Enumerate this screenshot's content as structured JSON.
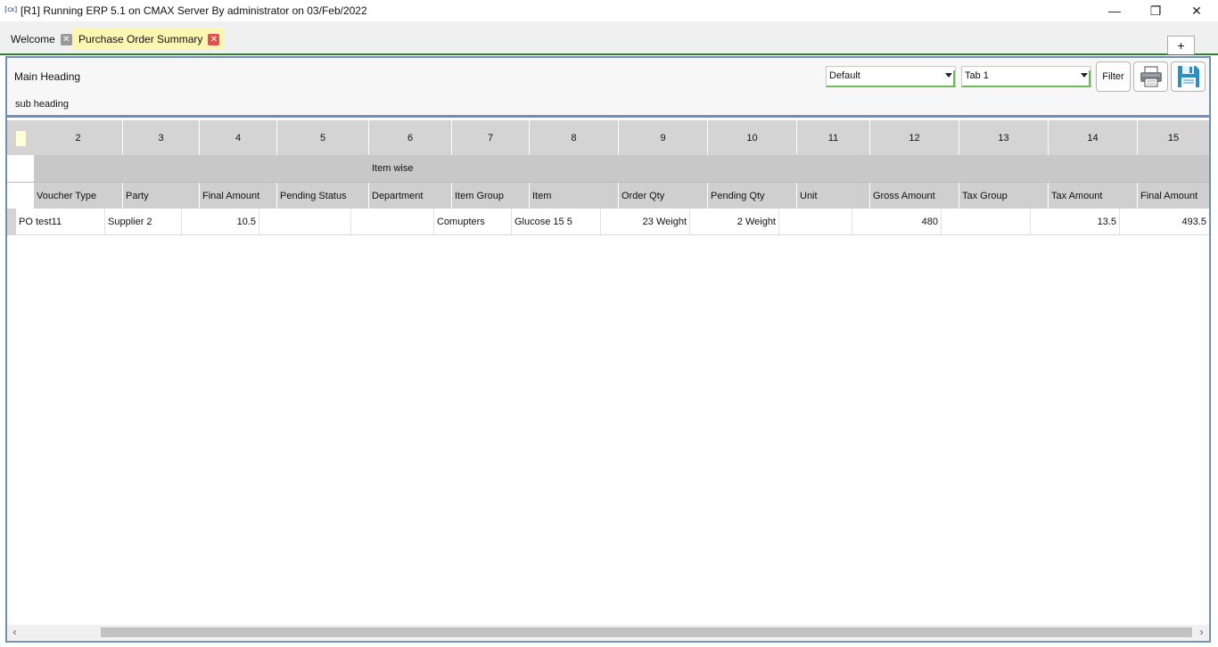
{
  "window": {
    "icon_text": "[cx]",
    "title": "[R1] Running ERP 5.1 on CMAX Server By administrator on 03/Feb/2022",
    "minimize": "—",
    "maximize": "❐",
    "close": "✕"
  },
  "tabs": [
    {
      "label": "Welcome",
      "close": "✕"
    },
    {
      "label": "Purchase Order Summary",
      "close": "✕"
    }
  ],
  "add_tab": "+",
  "header": {
    "main_heading": "Main Heading",
    "sub_heading": "sub heading",
    "view_select": "Default",
    "tab_select": "Tab 1",
    "filter_label": "Filter"
  },
  "grid": {
    "column_numbers": [
      "2",
      "3",
      "4",
      "5",
      "6",
      "7",
      "8",
      "9",
      "10",
      "11",
      "12",
      "13",
      "14",
      "15"
    ],
    "group_label": "Item wise",
    "headers": [
      "Voucher Type",
      "Party",
      "Final Amount",
      "Pending Status",
      "Department",
      "Item Group",
      "Item",
      "Order Qty",
      "Pending Qty",
      "Unit",
      "Gross Amount",
      "Tax Group",
      "Tax Amount",
      "Final Amount"
    ],
    "rows": [
      [
        "PO test11",
        "Supplier 2",
        "10.5",
        "",
        "",
        "Comupters",
        "Glucose 15 5",
        "23 Weight",
        "2 Weight",
        "",
        "480",
        "",
        "13.5",
        "493.5"
      ]
    ]
  },
  "scrollbar": {
    "left": "‹",
    "right": "›"
  }
}
